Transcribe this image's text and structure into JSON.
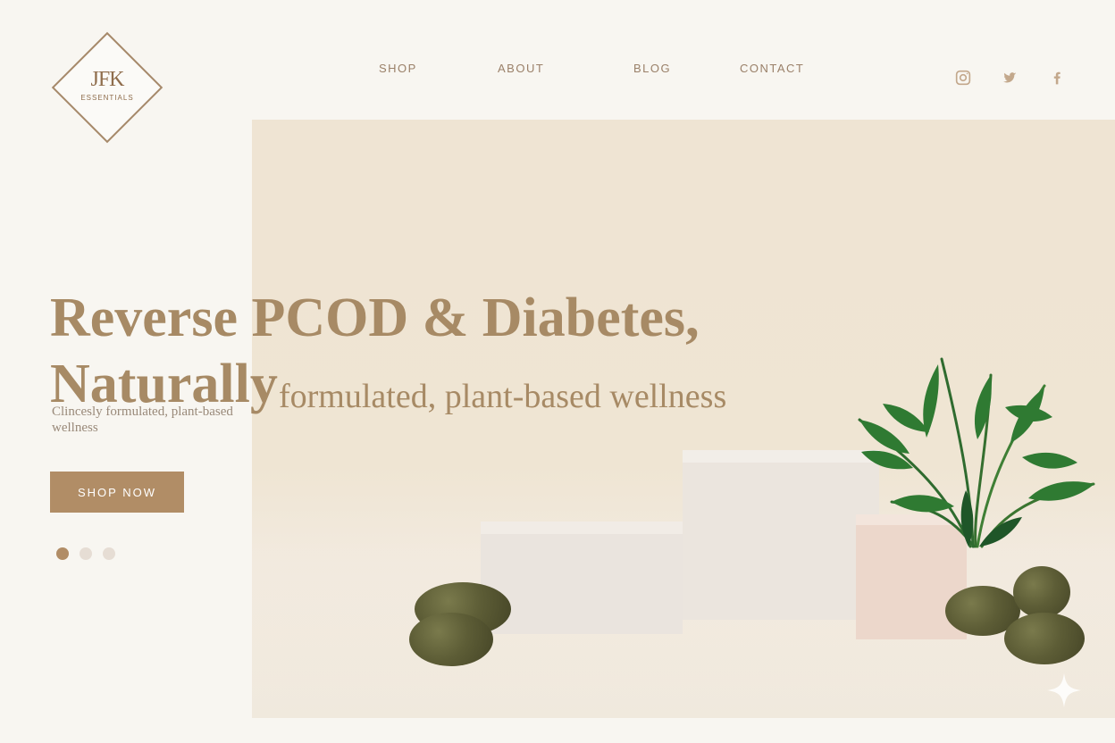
{
  "logo": {
    "mark": "JFK",
    "subtext": "ESSENTIALS"
  },
  "nav": {
    "items": [
      {
        "label": "SHOP"
      },
      {
        "label": "ABOUT"
      },
      {
        "label": "BLOG"
      },
      {
        "label": "CONTACT"
      }
    ]
  },
  "social": {
    "items": [
      {
        "icon": "instagram-icon"
      },
      {
        "icon": "twitter-icon"
      },
      {
        "icon": "facebook-icon"
      }
    ]
  },
  "hero": {
    "title_line1": "Reverse PCOD & Diabetes,",
    "title_line2": "Naturally",
    "overlay_text": "formulated, plant-based wellness",
    "small_copy": "Clincesly formulated, plant-based wellness",
    "button_label": "SHOP NOW",
    "carousel": {
      "active_index": 0,
      "count": 3
    }
  },
  "colors": {
    "accent": "#b18d66",
    "background": "#f8f6f1",
    "panel": "#efe4d3"
  }
}
